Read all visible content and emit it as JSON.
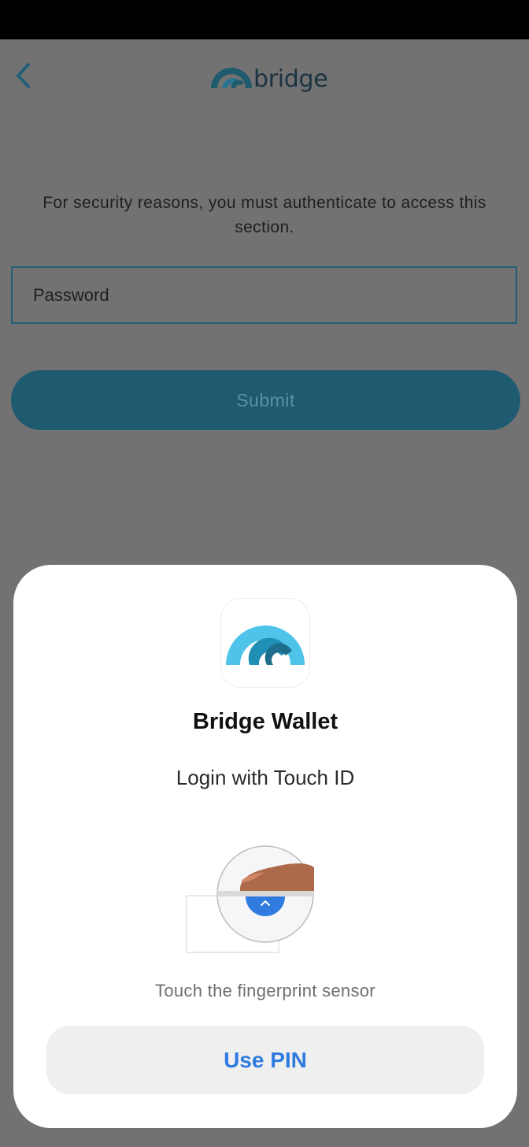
{
  "header": {
    "back_icon": "chevron-left-icon",
    "logo_text": "bridge"
  },
  "main": {
    "security_message": "For security reasons, you must authenticate to access this section.",
    "password_placeholder": "Password",
    "password_value": "",
    "submit_label": "Submit"
  },
  "biometric_sheet": {
    "app_name": "Bridge Wallet",
    "subtitle": "Login with Touch ID",
    "instruction": "Touch the fingerprint sensor",
    "use_pin_label": "Use PIN",
    "illustration_icon": "fingerprint-sensor-icon"
  },
  "colors": {
    "brand_dark": "#1e5b71",
    "brand_light": "#4fc3ea",
    "accent_blue": "#2f7be0",
    "overlay": "#727272"
  }
}
